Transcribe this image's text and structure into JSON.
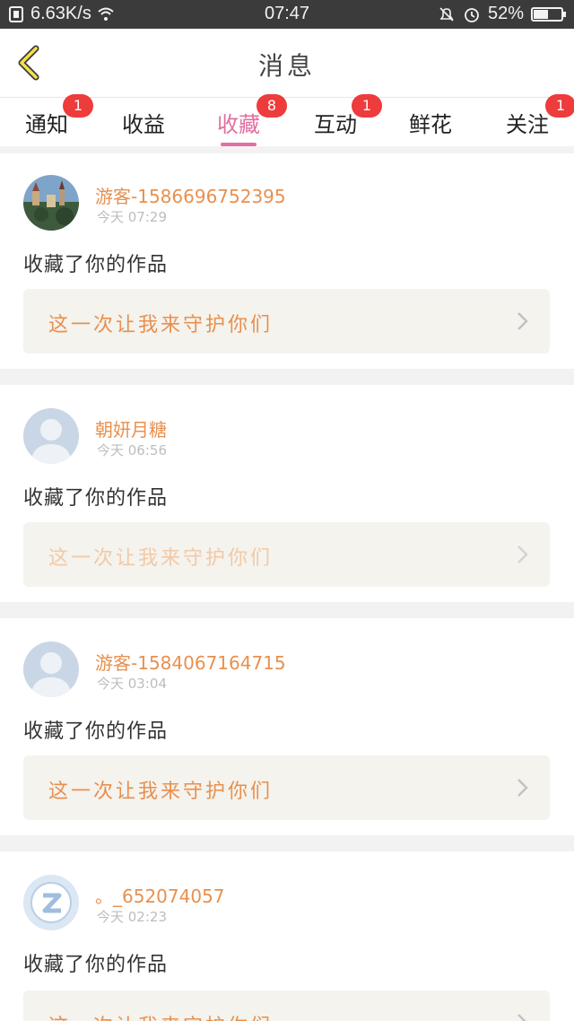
{
  "status_bar": {
    "speed": "6.63K/s",
    "time": "07:47",
    "battery": "52%",
    "icons": [
      "sim-icon",
      "wifi-icon",
      "mute-icon",
      "alarm-icon",
      "battery-icon"
    ]
  },
  "header": {
    "title": "消息",
    "back_icon": "back-chevron-icon"
  },
  "tabs": [
    {
      "label": "通知",
      "badge": "1"
    },
    {
      "label": "收益",
      "badge": ""
    },
    {
      "label": "收藏",
      "badge": "8",
      "active": true
    },
    {
      "label": "互动",
      "badge": "1"
    },
    {
      "label": "鲜花",
      "badge": ""
    },
    {
      "label": "关注",
      "badge": "1"
    }
  ],
  "messages": [
    {
      "username": "游客-1586696752395",
      "time": "今天 07:29",
      "action": "收藏了你的作品",
      "work_title": "这一次让我来守护你们",
      "avatar": "landscape-avatar"
    },
    {
      "username": "朝妍月糖",
      "time": "今天 06:56",
      "action": "收藏了你的作品",
      "work_title": "这一次让我来守护你们",
      "avatar": "default-avatar"
    },
    {
      "username": "游客-1584067164715",
      "time": "今天 03:04",
      "action": "收藏了你的作品",
      "work_title": "这一次让我来守护你们",
      "avatar": "default-avatar"
    },
    {
      "username": "。_652074057",
      "time": "今天 02:23",
      "action": "收藏了你的作品",
      "work_title": "这一次让我来守护你们",
      "avatar": "qq-avatar"
    }
  ],
  "colors": {
    "accent": "#e16fa1",
    "username": "#e8904e",
    "badge": "#ee3b3b",
    "status_bar": "#3b3b3b"
  }
}
